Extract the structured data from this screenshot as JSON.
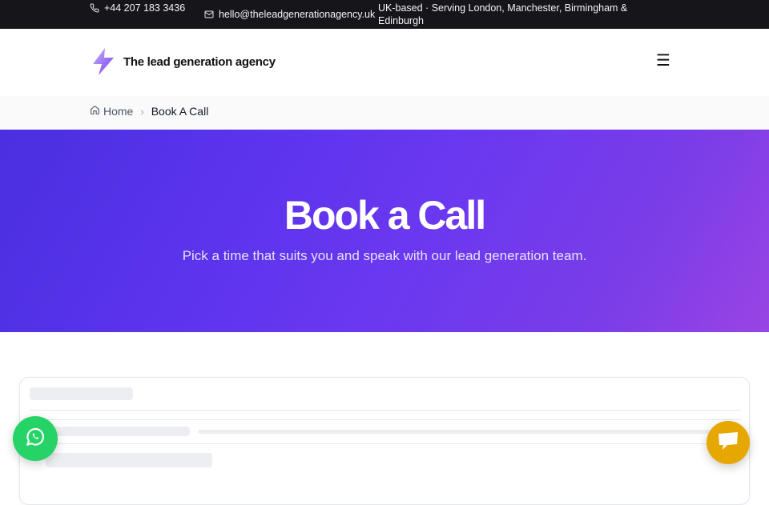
{
  "topbar": {
    "phone": "+44 207 183 3436",
    "email": "hello@theleadgenerationagency.uk",
    "location": "UK-based · Serving London, Manchester, Birmingham & Edinburgh"
  },
  "header": {
    "logo_text": "The lead generation agency",
    "menu_glyph": "☰"
  },
  "breadcrumb": {
    "home": "Home",
    "separator": "›",
    "current": "Book A Call"
  },
  "hero": {
    "title": "Book a Call",
    "subtitle": "Pick a time that suits you and speak with our lead generation team."
  },
  "colors": {
    "topbar_bg": "#16161a",
    "hero_gradient_start": "#4a2fe0",
    "hero_gradient_end": "#9a44e4",
    "whatsapp": "#25d366",
    "chat": "#e6a800"
  },
  "icons": {
    "phone": "phone-icon",
    "email": "mail-icon",
    "home": "home-icon",
    "menu": "hamburger-menu-icon",
    "whatsapp": "whatsapp-icon",
    "chat": "chat-icon",
    "logo": "lightning-bolt-icon"
  }
}
